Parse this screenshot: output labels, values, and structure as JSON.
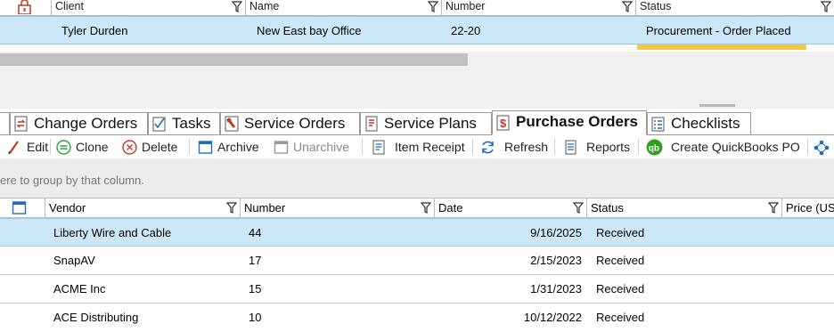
{
  "top_grid": {
    "columns": [
      "Client",
      "Name",
      "Number",
      "Status"
    ],
    "row": {
      "client": "Tyler Durden",
      "name": "New East bay Office",
      "number": "22-20",
      "status": "Procurement - Order Placed"
    }
  },
  "tabs": [
    "Change Orders",
    "Tasks",
    "Service Orders",
    "Service Plans",
    "Purchase Orders",
    "Checklists"
  ],
  "active_tab": "Purchase Orders",
  "toolbar": {
    "edit": "Edit",
    "clone": "Clone",
    "delete": "Delete",
    "archive": "Archive",
    "unarchive": "Unarchive",
    "item_receipt": "Item Receipt",
    "refresh": "Refresh",
    "reports": "Reports",
    "create_qb_po": "Create QuickBooks PO"
  },
  "group_panel_text": "ere to group by that column.",
  "po_grid": {
    "columns": [
      "Vendor",
      "Number",
      "Date",
      "Status",
      "Price (US"
    ],
    "rows": [
      {
        "vendor": "Liberty Wire and Cable",
        "number": "44",
        "date": "9/16/2025",
        "status": "Received"
      },
      {
        "vendor": "SnapAV",
        "number": "17",
        "date": "2/15/2023",
        "status": "Received"
      },
      {
        "vendor": "ACME Inc",
        "number": "15",
        "date": "1/31/2023",
        "status": "Received"
      },
      {
        "vendor": "ACE Distributing",
        "number": "10",
        "date": "10/12/2022",
        "status": "Received"
      }
    ]
  },
  "colors": {
    "selection": "#cce8f8",
    "status_bar": "#f2c94c",
    "accent_red": "#c0392b",
    "accent_blue": "#1f6fb4"
  }
}
